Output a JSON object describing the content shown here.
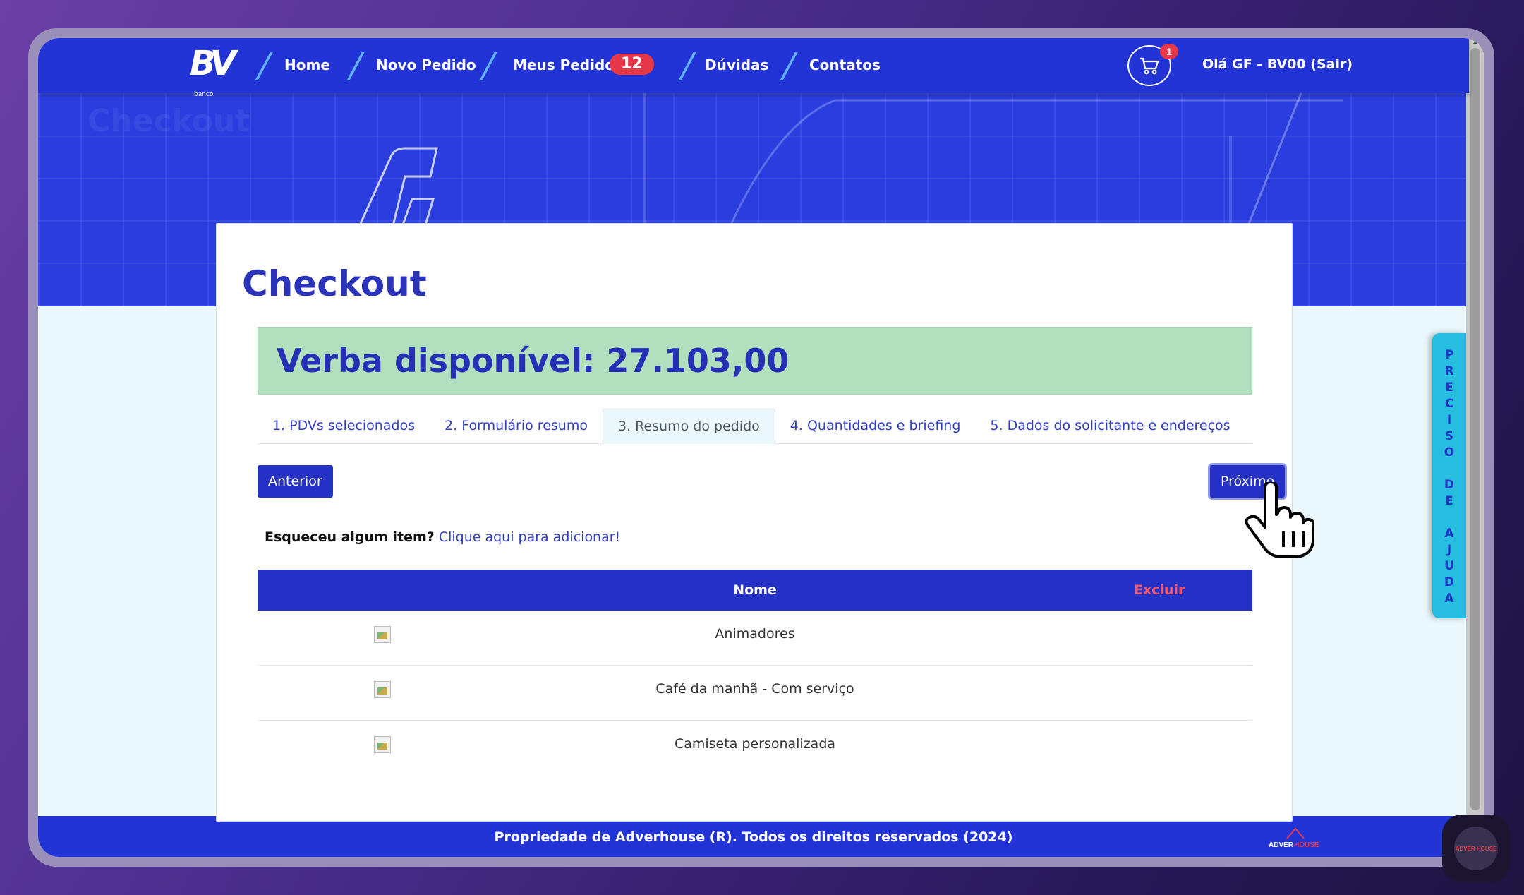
{
  "nav": {
    "logo_text": "BV",
    "logo_sub": "banco",
    "links": [
      "Home",
      "Novo Pedido",
      "Meus Pedidos",
      "Dúvidas",
      "Contatos"
    ],
    "orders_badge": "12",
    "cart_count": "1",
    "greeting": "Olá GF - BV00 (Sair)"
  },
  "hero": {
    "ghost_text": "Checkout"
  },
  "page": {
    "title": "Checkout",
    "budget": "Verba disponível: 27.103,00",
    "tabs": [
      "1. PDVs selecionados",
      "2. Formulário resumo",
      "3. Resumo do pedido",
      "4. Quantidades e briefing",
      "5. Dados do solicitante e endereços"
    ],
    "active_tab": "3. Resumo do pedido",
    "prev_label": "Anterior",
    "next_label": "Próximo",
    "forgot_label": "Esqueceu algum item?",
    "forgot_link": "Clique aqui para adicionar!"
  },
  "table": {
    "col_name": "Nome",
    "col_delete": "Excluir",
    "rows": [
      "Animadores",
      "Café da manhã - Com serviço",
      "Camiseta personalizada"
    ]
  },
  "footer": {
    "text": "Propriedade de Adverhouse (R). Todos os direitos reservados (2024)",
    "logo": "ADVERHOUSE"
  },
  "help_tab": {
    "label": "PRECISO DE AJUDA"
  },
  "chat": {
    "label": "ADVER HOUSE"
  },
  "colors": {
    "primary": "#2234d6",
    "accent": "#27bde0",
    "danger": "#e53849",
    "budget_bg": "#b2e0bf"
  }
}
